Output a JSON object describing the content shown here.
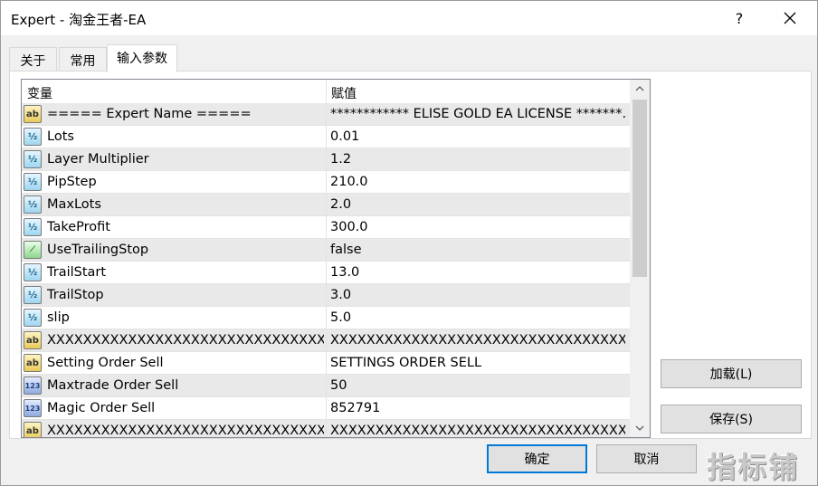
{
  "window": {
    "title": "Expert - 淘金王者-EA",
    "help_label": "?",
    "close_icon": "close-icon"
  },
  "tabs": [
    {
      "label": "关于",
      "active": false
    },
    {
      "label": "常用",
      "active": false
    },
    {
      "label": "输入参数",
      "active": true
    }
  ],
  "grid": {
    "col_variable": "变量",
    "col_value": "赋值",
    "rows": [
      {
        "type": "string",
        "name": "===== Expert Name =====",
        "value": "************ ELISE GOLD EA LICENSE *******..."
      },
      {
        "type": "double",
        "name": "Lots",
        "value": "0.01"
      },
      {
        "type": "double",
        "name": "Layer Multiplier",
        "value": "1.2"
      },
      {
        "type": "double",
        "name": "PipStep",
        "value": "210.0"
      },
      {
        "type": "double",
        "name": "MaxLots",
        "value": "2.0"
      },
      {
        "type": "double",
        "name": "TakeProfit",
        "value": "300.0"
      },
      {
        "type": "bool",
        "name": "UseTrailingStop",
        "value": "false"
      },
      {
        "type": "double",
        "name": "TrailStart",
        "value": "13.0"
      },
      {
        "type": "double",
        "name": "TrailStop",
        "value": "3.0"
      },
      {
        "type": "double",
        "name": "slip",
        "value": "5.0"
      },
      {
        "type": "string",
        "name": "XXXXXXXXXXXXXXXXXXXXXXXXXXXXXXX...",
        "value": "XXXXXXXXXXXXXXXXXXXXXXXXXXXXXXXXXX"
      },
      {
        "type": "string",
        "name": "Setting Order Sell",
        "value": "SETTINGS ORDER SELL"
      },
      {
        "type": "int",
        "name": "Maxtrade Order Sell",
        "value": "50"
      },
      {
        "type": "int",
        "name": "Magic Order Sell",
        "value": "852791"
      },
      {
        "type": "string",
        "name": "XXXXXXXXXXXXXXXXXXXXXXXXXXXXXXX...",
        "value": "XXXXXXXXXXXXXXXXXXXXXXXXXXXXXXXXXX"
      }
    ]
  },
  "icons": {
    "string": {
      "glyph": "ab",
      "name": "string-type-icon"
    },
    "double": {
      "glyph": "½",
      "name": "double-type-icon"
    },
    "bool": {
      "glyph": "⟋",
      "name": "bool-type-icon"
    },
    "int": {
      "glyph": "123",
      "name": "integer-type-icon"
    }
  },
  "buttons": {
    "load": "加载(L)",
    "save": "保存(S)",
    "ok": "确定",
    "cancel": "取消"
  },
  "watermark": "指标铺",
  "colors": {
    "default_button_border": "#0078d7",
    "shaded_row": "#e9e9e9"
  }
}
